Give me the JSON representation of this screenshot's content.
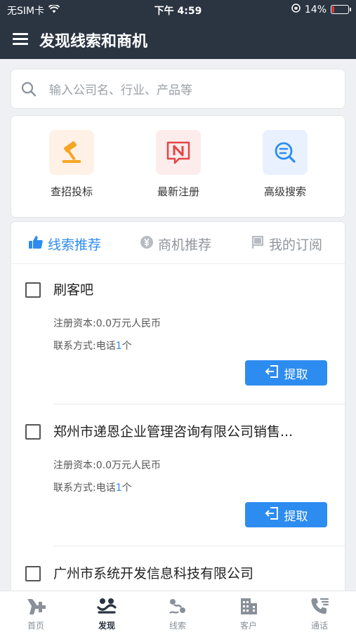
{
  "status_bar": {
    "carrier": "无SIM卡",
    "time": "下午 4:59",
    "battery": "14%",
    "battery_level": 0.14
  },
  "header": {
    "title": "发现线索和商机"
  },
  "search": {
    "placeholder": "输入公司名、行业、产品等"
  },
  "quick_actions": [
    {
      "label": "查招投标",
      "icon": "gavel-icon",
      "bg": "#fff1e6",
      "color": "#f5a623"
    },
    {
      "label": "最新注册",
      "icon": "new-badge-icon",
      "bg": "#fdecec",
      "color": "#e54545"
    },
    {
      "label": "高级搜索",
      "icon": "advanced-search-icon",
      "bg": "#e8f1fd",
      "color": "#2d8cf0"
    }
  ],
  "tabs": [
    {
      "label": "线索推荐",
      "icon": "thumbs-up-icon",
      "active": true
    },
    {
      "label": "商机推荐",
      "icon": "money-icon",
      "active": false
    },
    {
      "label": "我的订阅",
      "icon": "bookmark-flag-icon",
      "active": false
    }
  ],
  "leads": [
    {
      "name": "刷客吧",
      "capital_label": "注册资本:",
      "capital": "0.0万元人民币",
      "contact_label": "联系方式:",
      "contact_prefix": "电话",
      "contact_count": "1",
      "contact_suffix": "个",
      "action": "提取"
    },
    {
      "name": "郑州市递恩企业管理咨询有限公司销售...",
      "capital_label": "注册资本:",
      "capital": "0.0万元人民币",
      "contact_label": "联系方式:",
      "contact_prefix": "电话",
      "contact_count": "1",
      "contact_suffix": "个",
      "action": "提取"
    },
    {
      "name": "广州市系统开发信息科技有限公司"
    }
  ],
  "bottom_nav": [
    {
      "label": "首页",
      "icon": "home-icon",
      "active": false
    },
    {
      "label": "发现",
      "icon": "discover-icon",
      "active": true
    },
    {
      "label": "线索",
      "icon": "leads-icon",
      "active": false
    },
    {
      "label": "客户",
      "icon": "building-icon",
      "active": false
    },
    {
      "label": "通话",
      "icon": "phone-call-icon",
      "active": false
    }
  ],
  "colors": {
    "header_bg": "#2b3441",
    "accent": "#2d8cf0",
    "page_bg": "#eef0f3"
  }
}
